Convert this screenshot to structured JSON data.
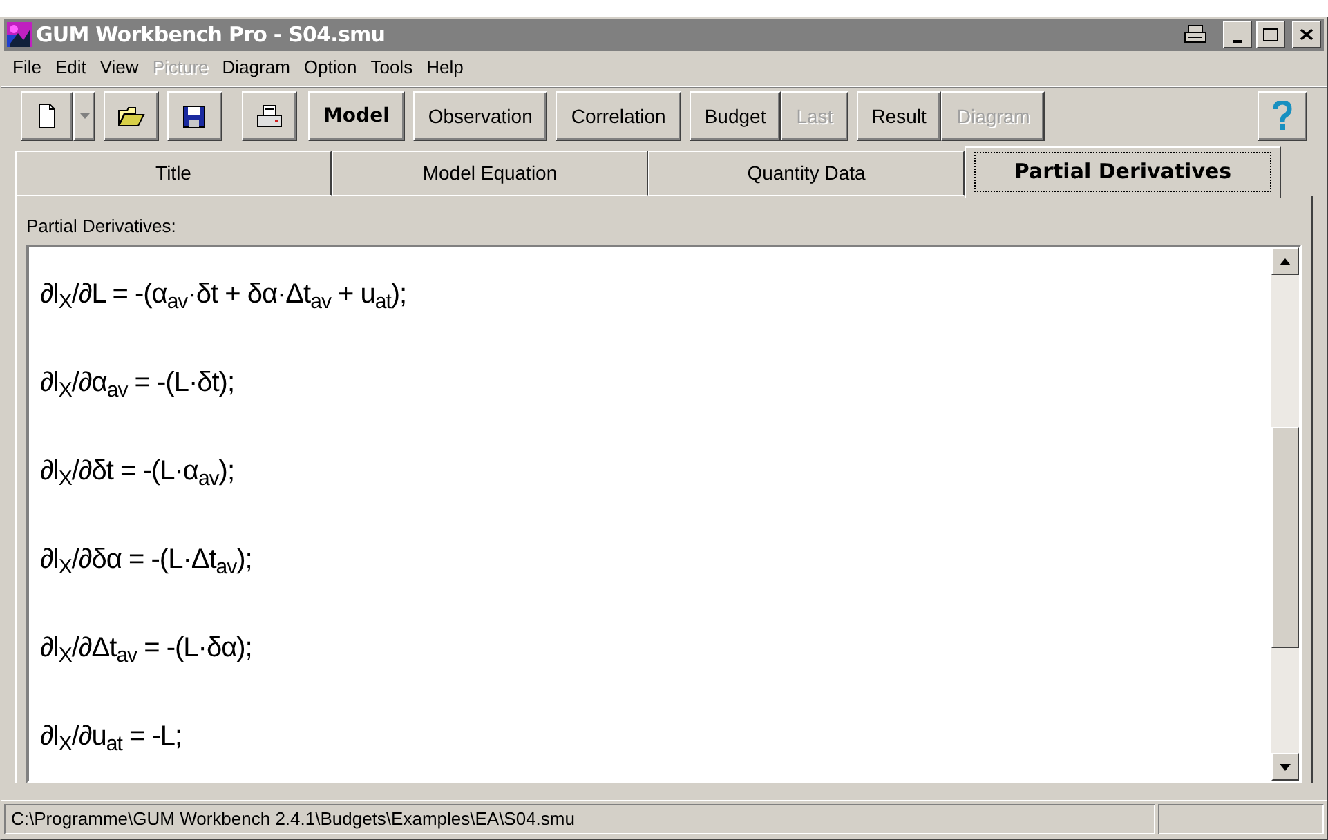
{
  "window": {
    "title": "GUM Workbench Pro - S04.smu"
  },
  "menu": [
    {
      "label": "File",
      "disabled": false
    },
    {
      "label": "Edit",
      "disabled": false
    },
    {
      "label": "View",
      "disabled": false
    },
    {
      "label": "Picture",
      "disabled": true
    },
    {
      "label": "Diagram",
      "disabled": false
    },
    {
      "label": "Option",
      "disabled": false
    },
    {
      "label": "Tools",
      "disabled": false
    },
    {
      "label": "Help",
      "disabled": false
    }
  ],
  "toolbar": [
    {
      "kind": "new"
    },
    {
      "kind": "open"
    },
    {
      "kind": "save"
    },
    {
      "kind": "print"
    },
    {
      "kind": "text",
      "label": "Model",
      "bold": true,
      "disabled": false
    },
    {
      "kind": "text",
      "label": "Observation",
      "bold": false,
      "disabled": false
    },
    {
      "kind": "text",
      "label": "Correlation",
      "bold": false,
      "disabled": false
    },
    {
      "kind": "text",
      "label": "Budget",
      "bold": false,
      "disabled": false
    },
    {
      "kind": "text",
      "label": "Last",
      "bold": false,
      "disabled": true
    },
    {
      "kind": "text",
      "label": "Result",
      "bold": false,
      "disabled": false
    },
    {
      "kind": "text",
      "label": "Diagram",
      "bold": false,
      "disabled": true
    },
    {
      "kind": "help"
    }
  ],
  "tabs": [
    {
      "label": "Title",
      "selected": false
    },
    {
      "label": "Model Equation",
      "selected": false
    },
    {
      "label": "Quantity Data",
      "selected": false
    },
    {
      "label": "Partial Derivatives",
      "selected": true
    }
  ],
  "panel": {
    "label": "Partial Derivatives:",
    "equations": [
      "∂l$_{X}$/∂L = -(α$_{av}$·δt + δα·Δt$_{av}$ + u$_{at}$);",
      "∂l$_{X}$/∂α$_{av}$ = -(L·δt);",
      "∂l$_{X}$/∂δt = -(L·α$_{av}$);",
      "∂l$_{X}$/∂δα = -(L·Δt$_{av}$);",
      "∂l$_{X}$/∂Δt$_{av}$ = -(L·δα);",
      "∂l$_{X}$/∂u$_{at}$ = -L;"
    ]
  },
  "status_bar": {
    "path": "C:\\Programme\\GUM Workbench 2.4.1\\Budgets\\Examples\\EA\\S04.smu"
  }
}
